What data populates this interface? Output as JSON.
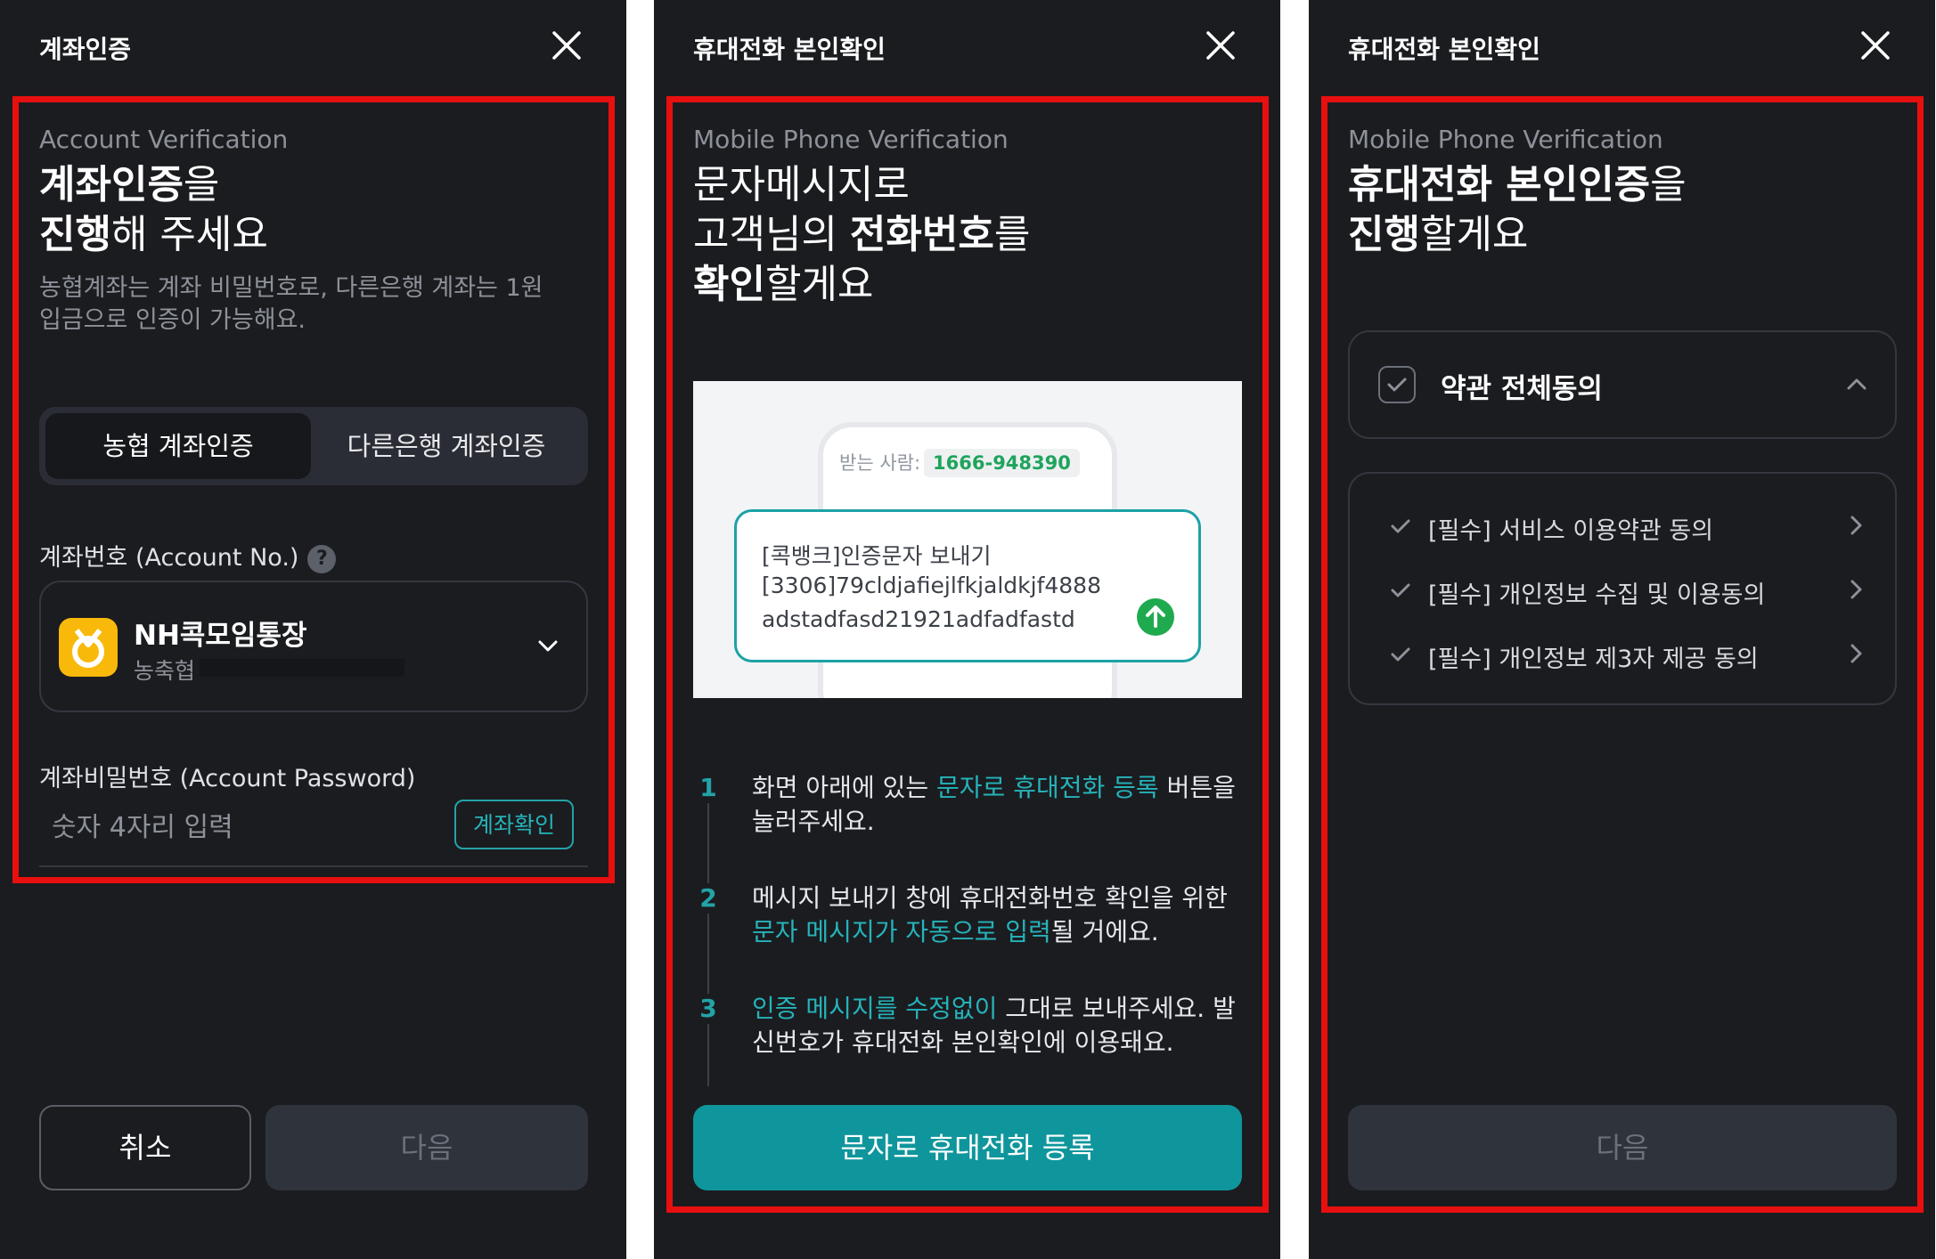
{
  "panel1": {
    "title": "계좌인증",
    "subtitle_en": "Account Verification",
    "headline": {
      "l1_bold": "계좌인증",
      "l1_rest": "을",
      "l2_bold": "진행",
      "l2_rest": "해 주세요"
    },
    "description_l1": "농협계좌는 계좌 비밀번호로, 다른은행 계좌는 1원",
    "description_l2": "입금으로 인증이 가능해요.",
    "tabs": [
      "농협 계좌인증",
      "다른은행 계좌인증"
    ],
    "active_tab": "농협 계좌인증",
    "account_label": "계좌번호 (Account No.)",
    "help_symbol": "?",
    "account": {
      "name": "NH콕모임통장",
      "bank": "농축협"
    },
    "password_label": "계좌비밀번호 (Account Password)",
    "password_placeholder": "숫자 4자리 입력",
    "verify_button": "계좌확인",
    "cancel_button": "취소",
    "next_button": "다음"
  },
  "panel2": {
    "title": "휴대전화 본인확인",
    "subtitle_en": "Mobile Phone Verification",
    "headline": {
      "l1": "문자메시지로",
      "l2_pre": "고객님의 ",
      "l2_bold": "전화번호",
      "l2_rest": "를",
      "l3_bold": "확인",
      "l3_rest": "할게요"
    },
    "illustration": {
      "recipient_label": "받는 사람:",
      "recipient_number": "1666-948390",
      "message_lines": [
        "[콕뱅크]인증문자 보내기",
        "[3306]79cldjafiejlfkjaldkjf4888",
        "adstadfasd21921adfadfastd"
      ]
    },
    "steps": [
      {
        "num": "1",
        "l1_pre": "화면 아래에 있는 ",
        "l1_hl": "문자로 휴대전화 등록",
        "l1_post": " 버튼을",
        "l2": "눌러주세요."
      },
      {
        "num": "2",
        "l1": "메시지 보내기 창에 휴대전화번호 확인을 위한",
        "l2_hl": "문자 메시지가 자동으로 입력",
        "l2_post": "될 거에요."
      },
      {
        "num": "3",
        "l1_hl": "인증 메시지를 수정없이",
        "l1_post": " 그대로 보내주세요. 발",
        "l2": "신번호가 휴대전화 본인확인에 이용돼요."
      }
    ],
    "primary_button": "문자로 휴대전화 등록"
  },
  "panel3": {
    "title": "휴대전화 본인확인",
    "subtitle_en": "Mobile Phone Verification",
    "headline": {
      "l1_bold": "휴대전화 본인인증",
      "l1_rest": "을",
      "l2_bold": "진행",
      "l2_rest": "할게요"
    },
    "agree_all": "약관 전체동의",
    "terms": [
      "[필수] 서비스 이용약관 동의",
      "[필수] 개인정보 수집 및 이용동의",
      "[필수] 개인정보 제3자 제공 동의"
    ],
    "next_button": "다음"
  },
  "colors": {
    "background": "#1b1c20",
    "accent": "#22a3a8",
    "highlight_border": "#e80f0f",
    "primary_button": "#0f969c",
    "disabled_button": "#2f343c"
  },
  "icons": [
    "close-icon",
    "help-icon",
    "chevron-down-icon",
    "bank-logo-icon",
    "send-icon",
    "checkbox-icon",
    "chevron-up-icon",
    "check-icon",
    "chevron-right-icon"
  ]
}
